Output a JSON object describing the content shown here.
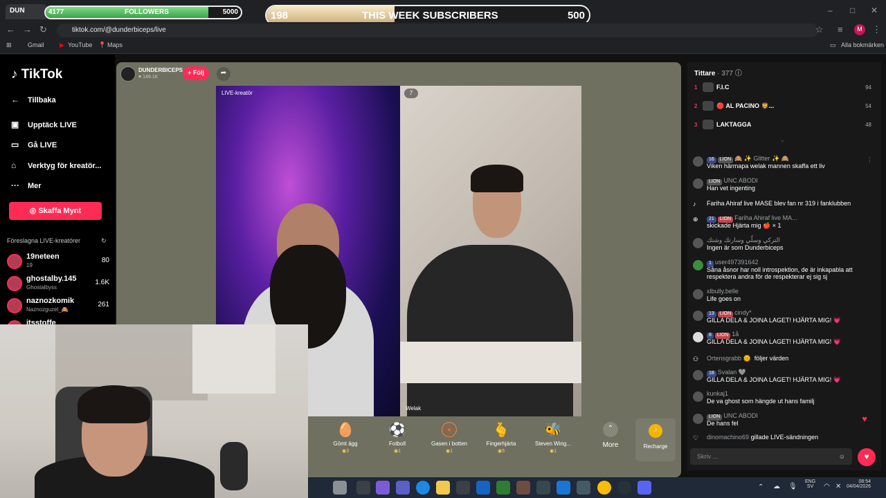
{
  "browser": {
    "tab_label": "DUN",
    "url": "tiktok.com/@dunderbiceps/live",
    "bookmarks": [
      "Gmail",
      "YouTube",
      "Maps"
    ],
    "all_bookmarks": "Alla bokmärken",
    "profile_initial": "M"
  },
  "overlay": {
    "followers": {
      "start": "4177",
      "label": "FOLLOWERS",
      "goal": "5000",
      "progress": 0.835
    },
    "subscribers": {
      "start": "198",
      "label": "THIS WEEK SUBSCRIBERS",
      "goal": "500",
      "progress": 0.396
    }
  },
  "sidebar": {
    "logo": "TikTok",
    "back": "Tillbaka",
    "items": [
      {
        "label": "Upptäck LIVE"
      },
      {
        "label": "Gå LIVE"
      },
      {
        "label": "Verktyg för kreatör..."
      },
      {
        "label": "Mer"
      }
    ],
    "coins_button": "Skaffa Mynt",
    "suggested_heading": "Föreslagna LIVE-kreatörer",
    "creators": [
      {
        "name": "19neteen",
        "sub": "19",
        "count": "80"
      },
      {
        "name": "ghostalby.145",
        "sub": "Ghostalbyss",
        "count": "1.6K"
      },
      {
        "name": "naznozkomik",
        "sub": "Naznozguzel_🙈",
        "count": "261"
      },
      {
        "name": "itsstoffe",
        "sub": "",
        "count": ""
      }
    ]
  },
  "live": {
    "host_name": "DUNDERBICEPS",
    "host_likes": "149.1K",
    "follow": "+ Följ",
    "left_label": "LIVE-kreatör",
    "guest_badge": "7",
    "guest_name": "Welak"
  },
  "gifts": [
    {
      "name": "Gömt ägg",
      "price": "3",
      "icon": "🥚"
    },
    {
      "name": "Fotboll",
      "price": "1",
      "icon": "⚽"
    },
    {
      "name": "Gasen i botten",
      "price": "1",
      "icon": "🛞"
    },
    {
      "name": "Fingerhjärta",
      "price": "5",
      "icon": "🫰"
    },
    {
      "name": "Steven Wing...",
      "price": "1",
      "icon": "🐝"
    }
  ],
  "more_label": "More",
  "recharge_label": "Recharge",
  "viewers": {
    "title": "Tittare",
    "count": "· 377",
    "ranks": [
      {
        "rank": "1",
        "name": "F.I.C",
        "score": "94"
      },
      {
        "rank": "2",
        "name": "🔴 AL PACINO 🦁...",
        "score": "54"
      },
      {
        "rank": "3",
        "name": "LAKTAGGA",
        "score": "48"
      }
    ]
  },
  "chat": [
    {
      "badges": [
        "16",
        "LION"
      ],
      "user": "🙈 ✨ Glitter ✨ 🙈",
      "text": "Viken härmapa welak mannen skaffa ett liv"
    },
    {
      "badges": [
        "LION"
      ],
      "user": "UNC ABODI",
      "text": "Han vet ingenting"
    },
    {
      "badges": [],
      "user": "",
      "text": "Fariha Ahiraf live MASE  blev fan nr 319 i fanklubben"
    },
    {
      "badges": [
        "21",
        "LION"
      ],
      "user": "Fariha Ahiraf live MA...",
      "text": "skickade Hjärta mig 🍎 × 1"
    },
    {
      "badges": [],
      "user": "التركي وسلّي وسارتك وشتك",
      "text": "Ingen är som Dunderbiceps"
    },
    {
      "badges": [
        "1"
      ],
      "user": "user497391642",
      "text": "Såna åsnor har noll introspektion, de är inkapabla att respektera andra för de respekterar ej sig sj"
    },
    {
      "badges": [],
      "user": "xlbully.belle",
      "text": "Life goes on"
    },
    {
      "badges": [
        "13",
        "LION"
      ],
      "user": "cindy*",
      "text": "GILLA DELA & JOINA LAGET! HJÄRTA MIG! 💗"
    },
    {
      "badges": [
        "8",
        "LION"
      ],
      "user": "1å",
      "text": "GILLA DELA & JOINA LAGET! HJÄRTA MIG! 💗"
    },
    {
      "badges": [],
      "user": "Ortensgrabb 🌞",
      "text": "följer värden"
    },
    {
      "badges": [
        "18"
      ],
      "user": "Svalan 🩶",
      "text": "GILLA DELA & JOINA LAGET! HJÄRTA MIG! 💗"
    },
    {
      "badges": [],
      "user": "kunkaj1",
      "text": "De va ghost som hängde ut hans familj"
    },
    {
      "badges": [
        "LION"
      ],
      "user": "UNC ABODI",
      "text": "De hans fel"
    },
    {
      "badges": [],
      "user": "dinomachino69",
      "text": "gillade LIVE-sändningen"
    }
  ],
  "chat_placeholder": "Skriv ...",
  "taskbar": {
    "lang": "ENG",
    "lang2": "SV",
    "time": "08:54",
    "date": "04/04/2026"
  }
}
